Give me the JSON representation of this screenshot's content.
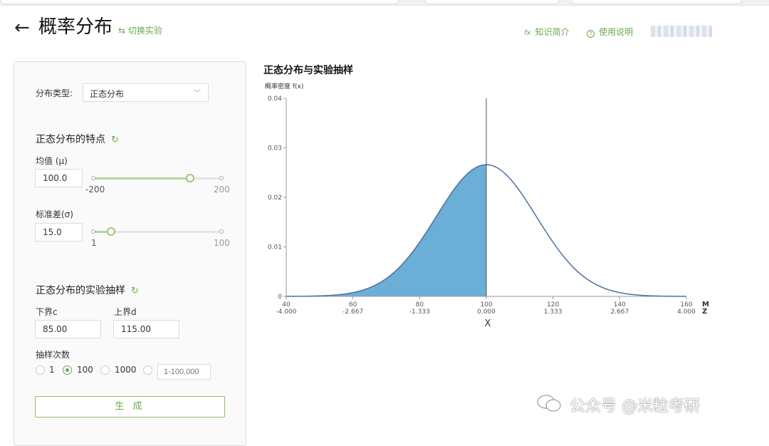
{
  "header": {
    "title": "概率分布",
    "back_glyph": "←",
    "switch_link": "⇆ 切换实验",
    "knowledge_icon": "fx",
    "knowledge_link": "知识简介",
    "help_icon": "?",
    "help_link": "使用说明"
  },
  "panel": {
    "dist_type_label": "分布类型:",
    "dist_type_value": "正态分布",
    "features_title": "正态分布的特点",
    "mean_label": "均值 (μ)",
    "mean_value": "100.0",
    "mean_slider": {
      "min": "-200",
      "max": "200",
      "value": 100
    },
    "std_label": "标准差(σ)",
    "std_value": "15.0",
    "std_slider": {
      "min": "1",
      "max": "100",
      "value": 15
    },
    "sampling_title": "正态分布的实验抽样",
    "lower_label": "下界c",
    "lower_value": "85.00",
    "upper_label": "上界d",
    "upper_value": "115.00",
    "count_label": "抽样次数",
    "count_options": [
      "1",
      "100",
      "1000"
    ],
    "count_selected": "100",
    "custom_placeholder": "1-100,000",
    "generate_button": "生 成"
  },
  "chart_data": {
    "type": "area",
    "title": "正态分布与实验抽样",
    "ylabel": "概率密度 f(x)",
    "xlabel": "X",
    "mean": 100,
    "std": 15,
    "x_ticks": [
      "40",
      "60",
      "80",
      "100",
      "120",
      "140",
      "160"
    ],
    "z_ticks": [
      "-4.000",
      "-2.667",
      "-1.333",
      "0.000",
      "1.333",
      "2.667",
      "4.000"
    ],
    "y_ticks": [
      "0",
      "0.01",
      "0.02",
      "0.03",
      "0.04"
    ],
    "xlim": [
      40,
      160
    ],
    "ylim": [
      0,
      0.04
    ],
    "shaded_range": [
      40,
      100
    ],
    "marker_x": 100,
    "axis_end_labels": [
      "M",
      "Z"
    ],
    "curve_color": "#4f6fa6",
    "fill_color": "#6baed6"
  },
  "watermark": "公众号 @米粒考研"
}
